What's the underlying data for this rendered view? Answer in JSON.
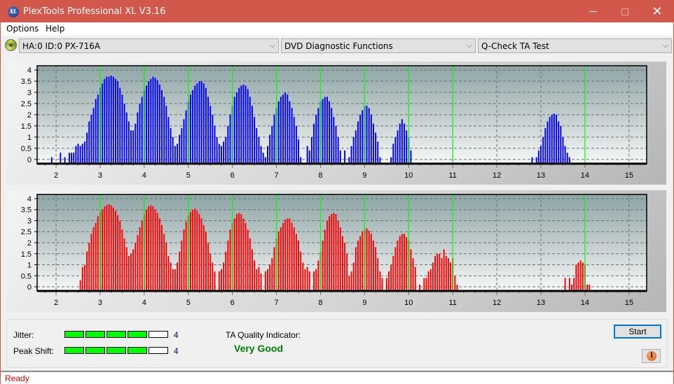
{
  "window": {
    "title": "PlexTools Professional XL V3.16",
    "app_icon_text": "XL",
    "minimize_icon": "minimize-icon",
    "maximize_icon": "maximize-icon",
    "close_icon": "close-icon",
    "close_glyph": "✕"
  },
  "menu": {
    "items": [
      "Options",
      "Help"
    ]
  },
  "toolbar": {
    "drive": "HA:0 ID:0  PX-716A",
    "function": "DVD Diagnostic Functions",
    "test": "Q-Check TA Test",
    "arrow_glyph": "⌵"
  },
  "colors": {
    "accent": "#d1584a",
    "series_top": "#0000ff",
    "series_bottom": "#ff0000",
    "marker": "#00ff00",
    "quality_text": "#008000",
    "status_text": "#e00000"
  },
  "chart_data": [
    {
      "type": "bar",
      "name": "top-chart",
      "title": "",
      "xlabel": "",
      "ylabel": "",
      "xlim": [
        1.57,
        15.4
      ],
      "ylim": [
        -0.19,
        4.19
      ],
      "xticks": [
        2,
        3,
        4,
        5,
        6,
        7,
        8,
        9,
        10,
        11,
        12,
        13,
        14,
        15
      ],
      "yticks": [
        0,
        0.5,
        1,
        1.5,
        2,
        2.5,
        3,
        3.5,
        4
      ],
      "ytick_labels": [
        "0",
        "0.5",
        "1",
        "1.5",
        "2",
        "2.5",
        "3",
        "3.5",
        "4"
      ],
      "grid": true,
      "reference_lines": [
        3,
        4,
        5,
        6,
        7,
        8,
        9,
        10,
        11,
        14
      ],
      "color": "#0000ff",
      "bins_start": 1.9,
      "bins_step": 0.05,
      "values": [
        0.1,
        0,
        0,
        0,
        0.3,
        0,
        0.1,
        0,
        0.3,
        0.3,
        0.3,
        0.6,
        0.7,
        0.6,
        0.7,
        0.8,
        1.2,
        1.7,
        2.0,
        2.3,
        2.7,
        2.9,
        3.2,
        3.4,
        3.6,
        3.7,
        3.7,
        3.75,
        3.7,
        3.6,
        3.5,
        3.2,
        2.9,
        2.5,
        2.1,
        1.7,
        1.3,
        1.3,
        1.6,
        2.1,
        2.5,
        2.8,
        3.1,
        3.3,
        3.5,
        3.6,
        3.7,
        3.65,
        3.55,
        3.35,
        3.1,
        2.8,
        2.4,
        1.9,
        1.4,
        1.0,
        0.6,
        0.7,
        1.1,
        1.4,
        1.8,
        2.2,
        2.6,
        2.9,
        3.1,
        3.3,
        3.4,
        3.5,
        3.5,
        3.4,
        3.2,
        2.8,
        2.4,
        2.0,
        1.5,
        1.0,
        0.7,
        0.6,
        0.8,
        1.0,
        1.5,
        2.0,
        2.4,
        2.8,
        3.0,
        3.2,
        3.3,
        3.35,
        3.3,
        3.15,
        2.8,
        2.4,
        1.9,
        1.4,
        1.0,
        0.6,
        0.3,
        0.1,
        0.6,
        1.1,
        1.5,
        2.0,
        2.3,
        2.6,
        2.8,
        2.9,
        3.0,
        2.9,
        2.6,
        2.3,
        1.9,
        1.5,
        0.9,
        0.1,
        0,
        0,
        0.6,
        0.4,
        1.0,
        1.6,
        2.0,
        2.3,
        2.6,
        2.7,
        2.8,
        2.8,
        2.6,
        2.3,
        1.9,
        1.5,
        1.0,
        0.4,
        0,
        0.4,
        0,
        0.1,
        0.6,
        1.0,
        1.3,
        1.7,
        2.0,
        2.2,
        2.4,
        2.4,
        2.3,
        2.0,
        1.6,
        1.2,
        0.8,
        0.1,
        0,
        0,
        0,
        0,
        0.1,
        0.7,
        1.0,
        1.3,
        1.6,
        1.8,
        1.6,
        1.3,
        1.0,
        0.4,
        0,
        0,
        0,
        0,
        0,
        0,
        0,
        0,
        0,
        0,
        0,
        0,
        0,
        0,
        0,
        0,
        0,
        0,
        0,
        0,
        0,
        0,
        0,
        0,
        0,
        0,
        0,
        0,
        0,
        0,
        0,
        0,
        0,
        0,
        0,
        0,
        0,
        0,
        0,
        0,
        0,
        0,
        0,
        0,
        0,
        0,
        0,
        0,
        0,
        0,
        0,
        0,
        0,
        0,
        0.1,
        0,
        0.1,
        0.4,
        0.6,
        1.0,
        1.4,
        1.7,
        1.9,
        2.0,
        2.05,
        2.0,
        1.7,
        1.5,
        1.0,
        0.6,
        0.3,
        0.1
      ]
    },
    {
      "type": "bar",
      "name": "bottom-chart",
      "title": "",
      "xlabel": "",
      "ylabel": "",
      "xlim": [
        1.57,
        15.4
      ],
      "ylim": [
        -0.19,
        4.19
      ],
      "xticks": [
        2,
        3,
        4,
        5,
        6,
        7,
        8,
        9,
        10,
        11,
        12,
        13,
        14,
        15
      ],
      "yticks": [
        0,
        0.5,
        1,
        1.5,
        2,
        2.5,
        3,
        3.5,
        4
      ],
      "ytick_labels": [
        "0",
        "0.5",
        "1",
        "1.5",
        "2",
        "2.5",
        "3",
        "3.5",
        "4"
      ],
      "grid": true,
      "reference_lines": [
        3,
        4,
        5,
        6,
        7,
        8,
        9,
        10,
        11,
        14
      ],
      "color": "#ff0000",
      "bins_start": 1.9,
      "bins_step": 0.05,
      "values": [
        0,
        0,
        0,
        0,
        0,
        0,
        0,
        0,
        0,
        0,
        0,
        0,
        0,
        0.3,
        0.9,
        1.0,
        1.6,
        2.0,
        2.4,
        2.7,
        2.9,
        3.2,
        3.4,
        3.5,
        3.65,
        3.7,
        3.75,
        3.7,
        3.6,
        3.45,
        3.25,
        3.0,
        2.6,
        2.2,
        1.8,
        1.4,
        1.5,
        1.7,
        2.0,
        2.35,
        2.7,
        3.0,
        3.3,
        3.5,
        3.65,
        3.7,
        3.65,
        3.5,
        3.35,
        3.1,
        2.8,
        2.4,
        2.0,
        1.4,
        1.1,
        0.8,
        0.8,
        1.1,
        1.6,
        2.1,
        2.6,
        2.95,
        3.2,
        3.4,
        3.5,
        3.55,
        3.45,
        3.3,
        3.1,
        2.8,
        2.5,
        2.0,
        1.5,
        1.1,
        0.7,
        0,
        0.7,
        0.8,
        1.1,
        1.6,
        2.1,
        2.6,
        2.9,
        3.1,
        3.3,
        3.35,
        3.3,
        3.1,
        2.9,
        2.6,
        2.2,
        1.7,
        1.2,
        0.8,
        0.9,
        0.6,
        0,
        0.7,
        0.8,
        1.0,
        1.3,
        1.8,
        2.2,
        2.5,
        2.7,
        2.9,
        3.05,
        3.1,
        3.1,
        2.9,
        2.7,
        2.4,
        2.1,
        1.6,
        1.1,
        0.8,
        0.9,
        0.7,
        0,
        0.7,
        0.8,
        1.2,
        1.6,
        2.1,
        2.6,
        3.0,
        3.2,
        3.3,
        3.35,
        3.3,
        3.0,
        2.7,
        2.3,
        2.0,
        1.5,
        0.5,
        0.7,
        1.1,
        1.8,
        2.1,
        2.3,
        2.5,
        2.6,
        2.65,
        2.55,
        2.4,
        2.1,
        1.8,
        1.3,
        0.7,
        0.4,
        0,
        0.4,
        0.7,
        1.0,
        1.4,
        1.8,
        2.1,
        2.3,
        2.4,
        2.4,
        2.25,
        2.1,
        1.7,
        1.3,
        0.9,
        0,
        0.1,
        0,
        0.4,
        0.4,
        0.7,
        0.8,
        1.1,
        1.4,
        1.5,
        1.5,
        1.3,
        1.7,
        1.4,
        1.3,
        1.1,
        1.3,
        0.5,
        0.1,
        0,
        0,
        0,
        0,
        0,
        0,
        0,
        0,
        0,
        0,
        0,
        0,
        0,
        0,
        0,
        0,
        0,
        0,
        0,
        0,
        0,
        0,
        0,
        0,
        0,
        0,
        0,
        0,
        0,
        0,
        0,
        0,
        0,
        0,
        0,
        0,
        0,
        0,
        0,
        0,
        0,
        0,
        0,
        0,
        0,
        0,
        0,
        0,
        0.4,
        0,
        0.4,
        0.1,
        0.4,
        1.0,
        1.1,
        1.2,
        1.1,
        1.0,
        0.1,
        0.1
      ]
    }
  ],
  "results": {
    "jitter_label": "Jitter:",
    "jitter_value": "4",
    "jitter_level": 4,
    "peak_shift_label": "Peak Shift:",
    "peak_shift_value": "4",
    "peak_shift_level": 4,
    "meter_max": 5,
    "ta_quality_label": "TA Quality Indicator:",
    "ta_quality_value": "Very Good"
  },
  "buttons": {
    "start": "Start",
    "info_glyph": "i"
  },
  "status": {
    "text": "Ready"
  }
}
